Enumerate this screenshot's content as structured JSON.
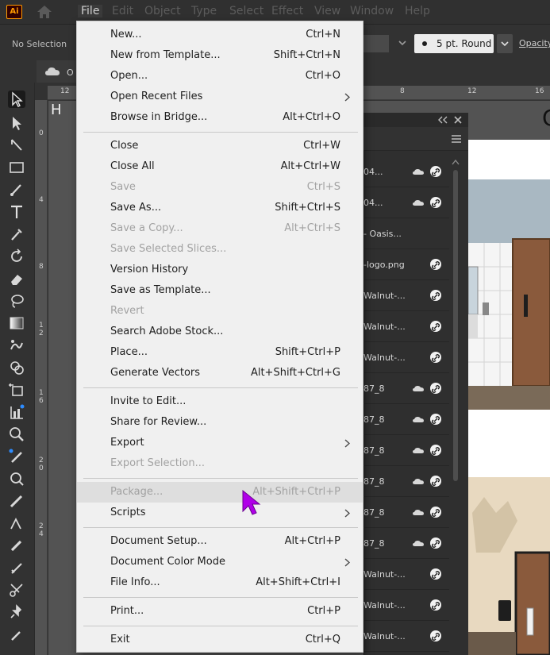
{
  "app": {
    "logo_text": "Ai"
  },
  "menubar": {
    "items": [
      "File",
      "Edit",
      "Object",
      "Type",
      "Select",
      "Effect",
      "View",
      "Window",
      "Help"
    ]
  },
  "controlbar": {
    "selection_status": "No Selection",
    "brush_value": "5 pt. Round",
    "opacity_label": "Opacity"
  },
  "tab": {
    "label_fragment": "O"
  },
  "ruler": {
    "top_ticks": [
      "12",
      "8",
      "12",
      "16"
    ],
    "left_ticks": [
      "0",
      "4",
      "8",
      "1\n2",
      "1\n6",
      "2\n0",
      "2\n4"
    ]
  },
  "canvas": {
    "h_letter": "H",
    "c_letter": "C"
  },
  "layers": {
    "rows": [
      {
        "name": "04...",
        "cloud": true,
        "link": true
      },
      {
        "name": "04...",
        "cloud": true,
        "link": true
      },
      {
        "name": "- Oasis...",
        "cloud": false,
        "link": false
      },
      {
        "name": "-logo.png",
        "cloud": false,
        "link": true
      },
      {
        "name": "Walnut-...",
        "cloud": false,
        "link": true
      },
      {
        "name": "Walnut-...",
        "cloud": false,
        "link": true
      },
      {
        "name": "Walnut-...",
        "cloud": false,
        "link": true
      },
      {
        "name": "87_8",
        "cloud": true,
        "link": true
      },
      {
        "name": "87_8",
        "cloud": true,
        "link": true
      },
      {
        "name": "87_8",
        "cloud": true,
        "link": true
      },
      {
        "name": "87_8",
        "cloud": true,
        "link": true
      },
      {
        "name": "87_8",
        "cloud": true,
        "link": true
      },
      {
        "name": "87_8",
        "cloud": true,
        "link": true
      },
      {
        "name": "Walnut-...",
        "cloud": false,
        "link": true
      },
      {
        "name": "Walnut-...",
        "cloud": false,
        "link": true
      },
      {
        "name": "Walnut-...",
        "cloud": false,
        "link": true
      }
    ]
  },
  "file_menu": {
    "items": [
      {
        "label": "New...",
        "shortcut": "Ctrl+N",
        "disabled": false,
        "submenu": false
      },
      {
        "label": "New from Template...",
        "shortcut": "Shift+Ctrl+N",
        "disabled": false,
        "submenu": false
      },
      {
        "label": "Open...",
        "shortcut": "Ctrl+O",
        "disabled": false,
        "submenu": false
      },
      {
        "label": "Open Recent Files",
        "shortcut": "",
        "disabled": false,
        "submenu": true
      },
      {
        "label": "Browse in Bridge...",
        "shortcut": "Alt+Ctrl+O",
        "disabled": false,
        "submenu": false
      },
      {
        "label": "Close",
        "shortcut": "Ctrl+W",
        "disabled": false,
        "submenu": false
      },
      {
        "label": "Close All",
        "shortcut": "Alt+Ctrl+W",
        "disabled": false,
        "submenu": false
      },
      {
        "label": "Save",
        "shortcut": "Ctrl+S",
        "disabled": true,
        "submenu": false
      },
      {
        "label": "Save As...",
        "shortcut": "Shift+Ctrl+S",
        "disabled": false,
        "submenu": false
      },
      {
        "label": "Save a Copy...",
        "shortcut": "Alt+Ctrl+S",
        "disabled": true,
        "submenu": false
      },
      {
        "label": "Save Selected Slices...",
        "shortcut": "",
        "disabled": true,
        "submenu": false
      },
      {
        "label": "Version History",
        "shortcut": "",
        "disabled": false,
        "submenu": false
      },
      {
        "label": "Save as Template...",
        "shortcut": "",
        "disabled": false,
        "submenu": false
      },
      {
        "label": "Revert",
        "shortcut": "",
        "disabled": true,
        "submenu": false
      },
      {
        "label": "Search Adobe Stock...",
        "shortcut": "",
        "disabled": false,
        "submenu": false
      },
      {
        "label": "Place...",
        "shortcut": "Shift+Ctrl+P",
        "disabled": false,
        "submenu": false
      },
      {
        "label": "Generate Vectors",
        "shortcut": "Alt+Shift+Ctrl+G",
        "disabled": false,
        "submenu": false
      },
      {
        "label": "Invite to Edit...",
        "shortcut": "",
        "disabled": false,
        "submenu": false
      },
      {
        "label": "Share for Review...",
        "shortcut": "",
        "disabled": false,
        "submenu": false
      },
      {
        "label": "Export",
        "shortcut": "",
        "disabled": false,
        "submenu": true
      },
      {
        "label": "Export Selection...",
        "shortcut": "",
        "disabled": true,
        "submenu": false
      },
      {
        "label": "Package...",
        "shortcut": "Alt+Shift+Ctrl+P",
        "disabled": true,
        "submenu": false
      },
      {
        "label": "Scripts",
        "shortcut": "",
        "disabled": false,
        "submenu": true
      },
      {
        "label": "Document Setup...",
        "shortcut": "Alt+Ctrl+P",
        "disabled": false,
        "submenu": false
      },
      {
        "label": "Document Color Mode",
        "shortcut": "",
        "disabled": false,
        "submenu": true
      },
      {
        "label": "File Info...",
        "shortcut": "Alt+Shift+Ctrl+I",
        "disabled": false,
        "submenu": false
      },
      {
        "label": "Print...",
        "shortcut": "Ctrl+P",
        "disabled": false,
        "submenu": false
      },
      {
        "label": "Exit",
        "shortcut": "Ctrl+Q",
        "disabled": false,
        "submenu": false
      }
    ]
  },
  "colors": {
    "cursor": "#b000e8",
    "accent_blue": "#2d8cff"
  }
}
